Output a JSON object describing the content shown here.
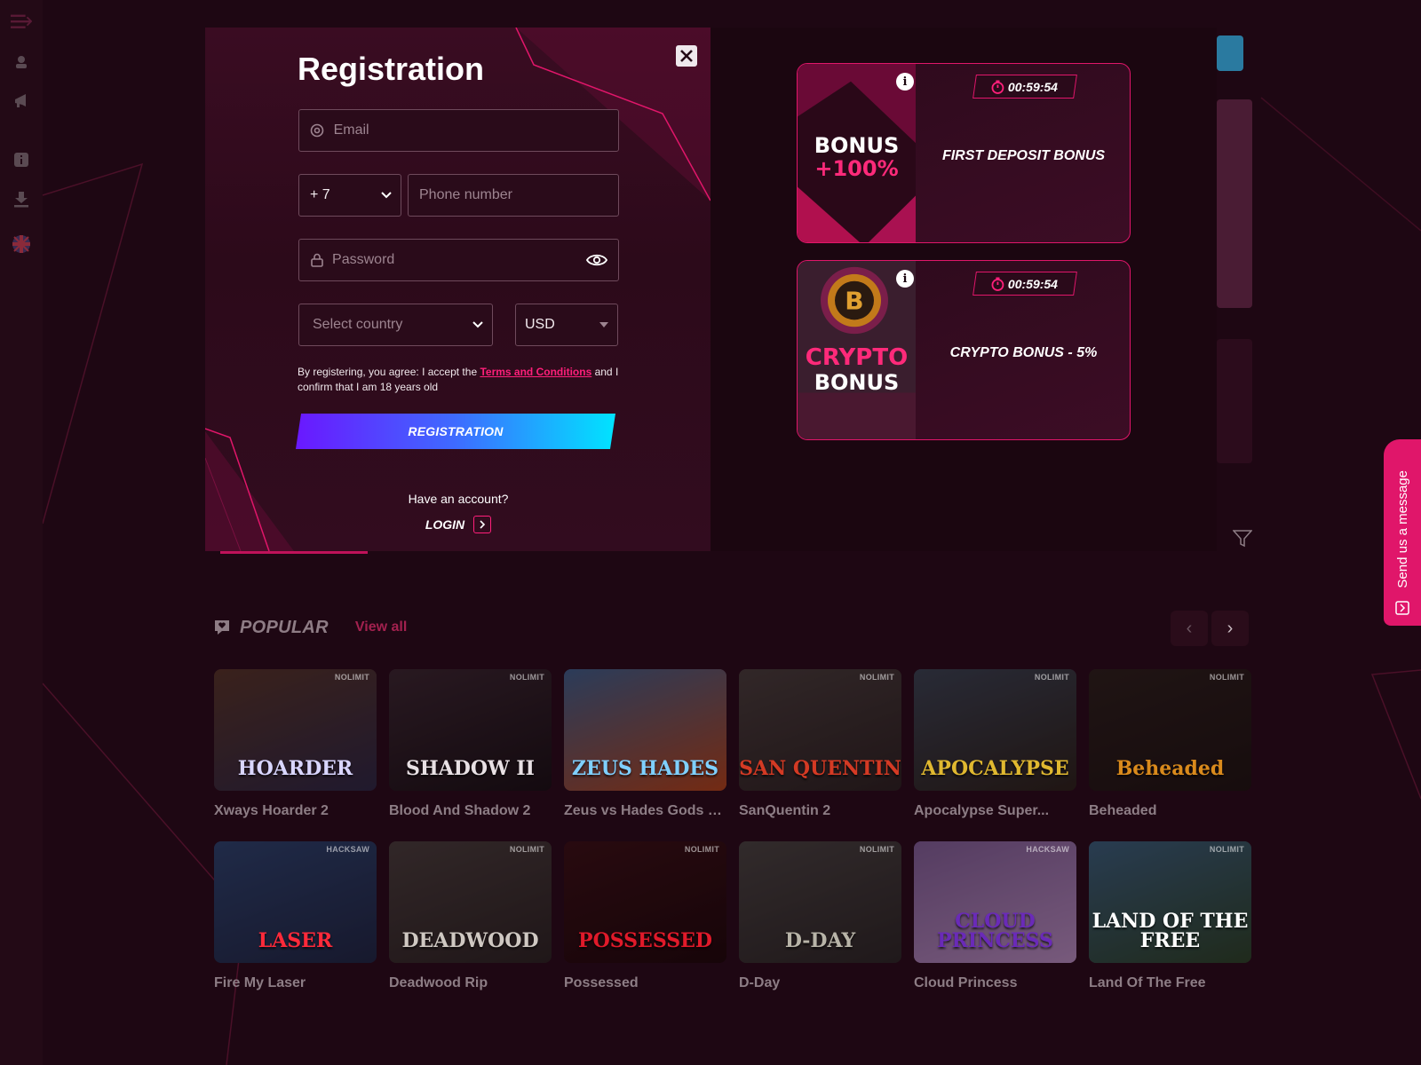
{
  "sidebar": {
    "icons": [
      "menu-icon",
      "user-icon",
      "megaphone-icon",
      "info-icon",
      "download-icon",
      "uk-flag-icon"
    ]
  },
  "registration": {
    "title": "Registration",
    "email_placeholder": "Email",
    "phone_code": "+ 7",
    "phone_placeholder": "Phone number",
    "password_placeholder": "Password",
    "country_placeholder": "Select country",
    "currency": "USD",
    "terms_prefix": "By registering, you agree: I accept the ",
    "terms_link": "Terms and Conditions",
    "terms_suffix": " and I confirm that I am 18 years old",
    "submit_label": "REGISTRATION",
    "have_account": "Have an account?",
    "login_label": "LOGIN"
  },
  "bonuses": [
    {
      "image_line1": "BONUS",
      "image_line2": "+100%",
      "timer": "00:59:54",
      "name": "FIRST DEPOSIT BONUS"
    },
    {
      "image_line1": "CRYPTO",
      "image_line2": "BONUS",
      "timer": "00:59:54",
      "name": "CRYPTO BONUS - 5%"
    }
  ],
  "popular": {
    "title": "POPULAR",
    "view_all": "View all",
    "games": [
      {
        "name": "Xways Hoarder 2",
        "art_title": "HOARDER",
        "provider": "NOLIMIT",
        "color1": "#5a3a2a",
        "color2": "#2b2b4a",
        "title_color": "#d9d6ff"
      },
      {
        "name": "Blood And Shadow 2",
        "art_title": "SHADOW II",
        "provider": "NOLIMIT",
        "color1": "#3a2a33",
        "color2": "#141014",
        "title_color": "#e8e0e4"
      },
      {
        "name": "Zeus vs Hades Gods of...",
        "art_title": "ZEUS HADES",
        "provider": "",
        "color1": "#3f6a9a",
        "color2": "#c24a1a",
        "title_color": "#7fd0ff"
      },
      {
        "name": "SanQuentin 2",
        "art_title": "SAN QUENTIN",
        "provider": "NOLIMIT",
        "color1": "#4a4440",
        "color2": "#2a2422",
        "title_color": "#d43a24"
      },
      {
        "name": "Apocalypse Super...",
        "art_title": "APOCALYPSE",
        "provider": "NOLIMIT",
        "color1": "#3a4a5a",
        "color2": "#2a241a",
        "title_color": "#e0b830"
      },
      {
        "name": "Beheaded",
        "art_title": "Beheaded",
        "provider": "NOLIMIT",
        "color1": "#2a221c",
        "color2": "#1a1410",
        "title_color": "#d98a1c"
      },
      {
        "name": "Fire My Laser",
        "art_title": "LASER",
        "provider": "HACKSAW",
        "color1": "#2a4a7a",
        "color2": "#1a2a4a",
        "title_color": "#ff2a3a"
      },
      {
        "name": "Deadwood Rip",
        "art_title": "DEADWOOD",
        "provider": "NOLIMIT",
        "color1": "#4a4440",
        "color2": "#2a2624",
        "title_color": "#cfc8c2"
      },
      {
        "name": "Possessed",
        "art_title": "POSSESSED",
        "provider": "NOLIMIT",
        "color1": "#3a1014",
        "color2": "#1a0608",
        "title_color": "#e01a2a"
      },
      {
        "name": "D-Day",
        "art_title": "D-DAY",
        "provider": "NOLIMIT",
        "color1": "#4a4a46",
        "color2": "#2a2a28",
        "title_color": "#b8b4a8"
      },
      {
        "name": "Cloud Princess",
        "art_title": "CLOUD PRINCESS",
        "provider": "HACKSAW",
        "color1": "#8a6aa8",
        "color2": "#c9a0d8",
        "title_color": "#6a2ab8"
      },
      {
        "name": "Land Of The Free",
        "art_title": "LAND OF THE FREE",
        "provider": "NOLIMIT",
        "color1": "#3a6a8a",
        "color2": "#2a4a2a",
        "title_color": "#ffffff"
      }
    ]
  },
  "chat": {
    "label": "Send us a message"
  },
  "colors": {
    "accent": "#e0166a",
    "background": "#1e0713",
    "button_start": "#6a18ff",
    "button_end": "#00e4ff"
  }
}
